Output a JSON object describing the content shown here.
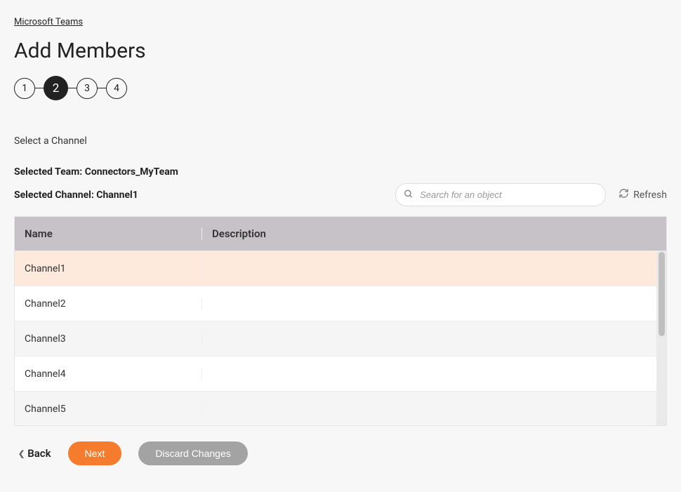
{
  "breadcrumb": {
    "label": "Microsoft Teams"
  },
  "page_title": "Add Members",
  "stepper": {
    "steps": [
      "1",
      "2",
      "3",
      "4"
    ],
    "active_index": 1
  },
  "subtitle": "Select a Channel",
  "selected_team": {
    "prefix": "Selected Team: ",
    "value": "Connectors_MyTeam"
  },
  "selected_channel": {
    "prefix": "Selected Channel: ",
    "value": "Channel1"
  },
  "search": {
    "placeholder": "Search for an object"
  },
  "refresh_label": "Refresh",
  "table": {
    "headers": {
      "name": "Name",
      "description": "Description"
    },
    "rows": [
      {
        "name": "Channel1",
        "description": "",
        "selected": true
      },
      {
        "name": "Channel2",
        "description": "",
        "selected": false
      },
      {
        "name": "Channel3",
        "description": "",
        "selected": false
      },
      {
        "name": "Channel4",
        "description": "",
        "selected": false
      },
      {
        "name": "Channel5",
        "description": "",
        "selected": false
      }
    ]
  },
  "footer": {
    "back": "Back",
    "next": "Next",
    "discard": "Discard Changes"
  }
}
